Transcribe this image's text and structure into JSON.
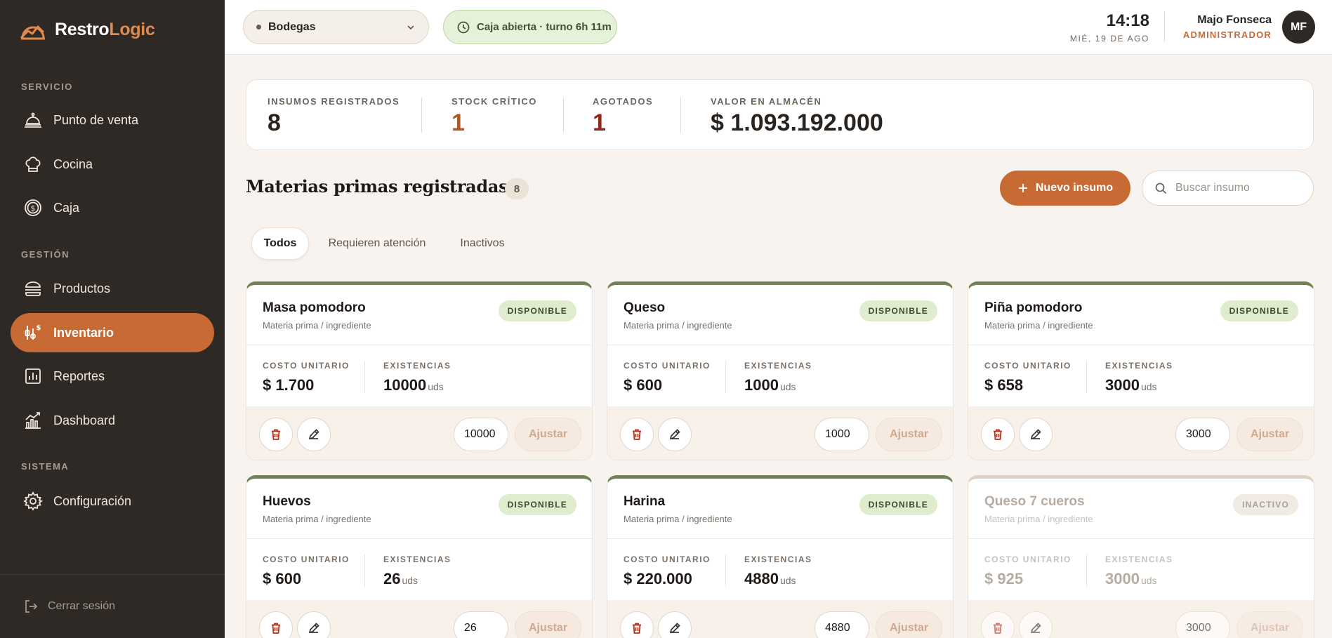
{
  "brand": {
    "name_part1": "Restro",
    "name_part2": "Logic",
    "logo_icon": "chart-mountain-logo-icon"
  },
  "colors": {
    "sidebar_bg": "#2f2925",
    "accent": "#c86a33",
    "success_bg": "#dfeccd",
    "success_bar": "#6f8354",
    "danger": "#8e2a1c",
    "page_bg": "#f8f3ee"
  },
  "sidebar": {
    "sections": [
      {
        "label": "SERVICIO",
        "items": [
          {
            "label": "Punto de venta",
            "icon": "cloche-icon"
          },
          {
            "label": "Cocina",
            "icon": "chef-hat-icon"
          },
          {
            "label": "Caja",
            "icon": "coin-icon"
          }
        ]
      },
      {
        "label": "GESTIÓN",
        "items": [
          {
            "label": "Productos",
            "icon": "burger-icon"
          },
          {
            "label": "Inventario",
            "icon": "inventory-icon",
            "active": true
          },
          {
            "label": "Reportes",
            "icon": "bar-chart-icon"
          },
          {
            "label": "Dashboard",
            "icon": "trend-chart-icon"
          }
        ]
      },
      {
        "label": "SISTEMA",
        "items": [
          {
            "label": "Configuración",
            "icon": "gear-icon"
          }
        ]
      }
    ],
    "logout_label": "Cerrar sesión"
  },
  "topbar": {
    "store": "Bodegas",
    "cash_status": "Caja abierta · turno 6h 11m",
    "time": "14:18",
    "date": "MIÉ, 19 DE AGO",
    "user_name": "Majo Fonseca",
    "user_role": "ADMINISTRADOR",
    "avatar_initials": "MF"
  },
  "stats": [
    {
      "label": "INSUMOS REGISTRADOS",
      "value": "8"
    },
    {
      "label": "STOCK CRÍTICO",
      "value": "1"
    },
    {
      "label": "AGOTADOS",
      "value": "1"
    },
    {
      "label": "VALOR EN ALMACÉN",
      "value": "$ 1.093.192.000"
    }
  ],
  "section": {
    "title": "Materias primas registradas",
    "count": "8",
    "new_button": "Nuevo insumo",
    "search_placeholder": "Buscar insumo"
  },
  "tabs": [
    {
      "label": "Todos",
      "active": true
    },
    {
      "label": "Requieren atención"
    },
    {
      "label": "Inactivos"
    }
  ],
  "card_labels": {
    "cost": "COSTO UNITARIO",
    "stock": "EXISTENCIAS",
    "unit": "uds",
    "adjust": "Ajustar"
  },
  "cards": [
    {
      "name": "Masa pomodoro",
      "type": "Materia prima / ingrediente",
      "status": "DISPONIBLE",
      "cost": "$ 1.700",
      "stock": "10000",
      "qty": "10000"
    },
    {
      "name": "Queso",
      "type": "Materia prima / ingrediente",
      "status": "DISPONIBLE",
      "cost": "$ 600",
      "stock": "1000",
      "qty": "1000"
    },
    {
      "name": "Piña pomodoro",
      "type": "Materia prima / ingrediente",
      "status": "DISPONIBLE",
      "cost": "$ 658",
      "stock": "3000",
      "qty": "3000"
    },
    {
      "name": "Huevos",
      "type": "Materia prima / ingrediente",
      "status": "DISPONIBLE",
      "cost": "$ 600",
      "stock": "26",
      "qty": "26"
    },
    {
      "name": "Harina",
      "type": "Materia prima / ingrediente",
      "status": "DISPONIBLE",
      "cost": "$ 220.000",
      "stock": "4880",
      "qty": "4880"
    },
    {
      "name": "Queso 7 cueros",
      "type": "Materia prima / ingrediente",
      "status": "INACTIVO",
      "cost": "$ 925",
      "stock": "3000",
      "qty": "3000",
      "inactive": true
    }
  ]
}
